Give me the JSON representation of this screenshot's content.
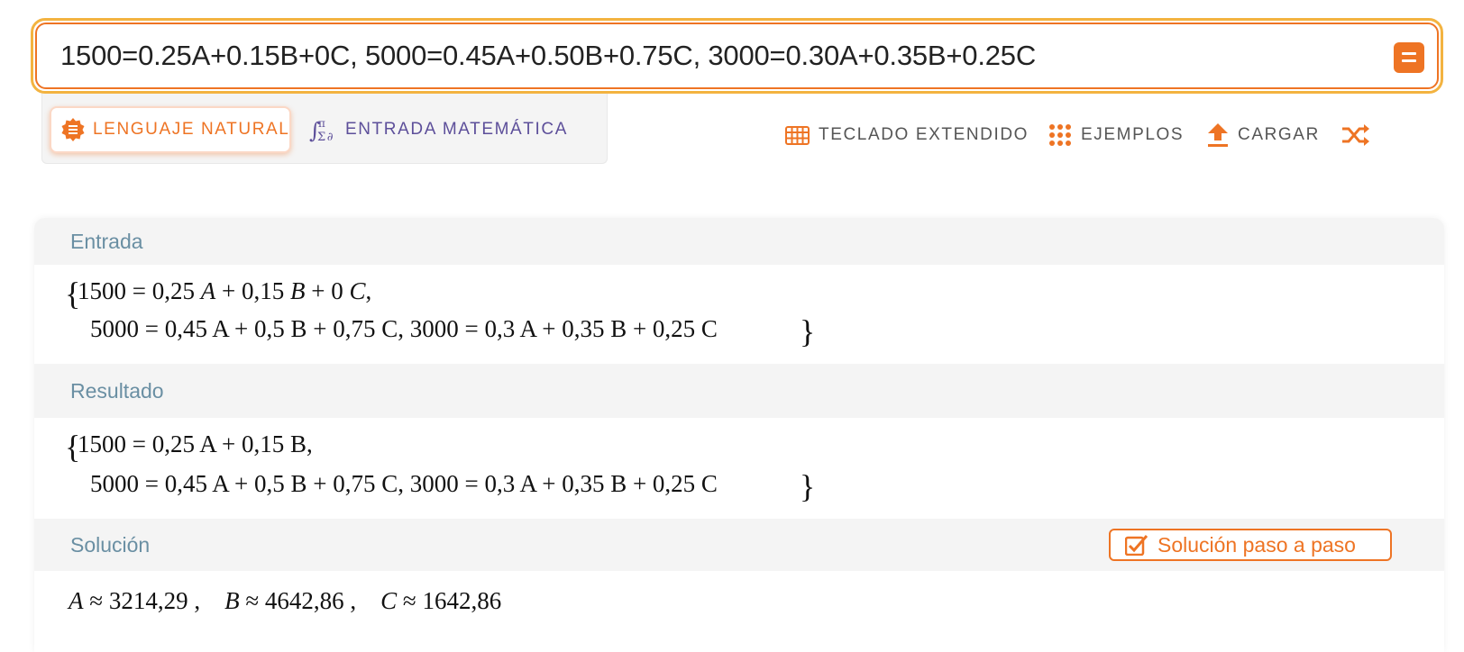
{
  "search": {
    "value": "1500=0.25A+0.15B+0C, 5000=0.45A+0.50B+0.75C, 3000=0.30A+0.35B+0.25C"
  },
  "input_modes": {
    "natural_label": "LENGUAJE NATURAL",
    "math_label": "ENTRADA MATEMÁTICA"
  },
  "toolbar": {
    "keyboard_label": "TECLADO EXTENDIDO",
    "examples_label": "EJEMPLOS",
    "upload_label": "CARGAR"
  },
  "sections": {
    "input": {
      "title": "Entrada",
      "line1_prefix": "1500 = 0,25 ",
      "line1_rest": " + 0,15 ",
      "line1_tail": " + 0 ",
      "line2": "5000 = 0,45 A + 0,5 B + 0,75 C, 3000 = 0,3 A + 0,35 B + 0,25 C"
    },
    "result": {
      "title": "Resultado",
      "line1": "1500 = 0,25 A + 0,15 B,",
      "line2": "5000 = 0,45 A + 0,5 B + 0,75 C, 3000 = 0,3 A + 0,35 B + 0,25 C"
    },
    "solution": {
      "title": "Solución",
      "step_button": "Solución paso a paso",
      "a_value": "3214,29",
      "b_value": "4642,86",
      "c_value": "1642,86"
    }
  },
  "colors": {
    "accent": "#ee7424",
    "highlight": "#f3b340",
    "math_purple": "#5d4f9a",
    "section_title": "#6a8fa3"
  },
  "icons": {
    "equals": "equals-icon",
    "natural": "badge-icon",
    "math": "math-symbols-icon",
    "keyboard": "grid-keyboard-icon",
    "examples": "dots-grid-icon",
    "upload": "upload-icon",
    "random": "shuffle-icon",
    "step": "checkbox-icon"
  }
}
